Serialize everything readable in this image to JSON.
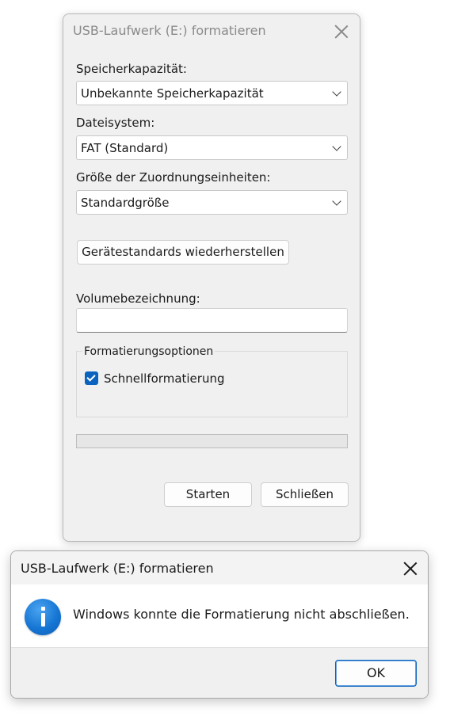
{
  "format_dialog": {
    "title": "USB-Laufwerk (E:) formatieren",
    "capacity_label": "Speicherkapazität:",
    "capacity_value": "Unbekannte Speicherkapazität",
    "filesystem_label": "Dateisystem:",
    "filesystem_value": "FAT (Standard)",
    "allocation_label": "Größe der Zuordnungseinheiten:",
    "allocation_value": "Standardgröße",
    "restore_defaults_label": "Gerätestandards wiederherstellen",
    "volume_label": "Volumebezeichnung:",
    "volume_value": "",
    "options_legend": "Formatierungsoptionen",
    "quick_format_label": "Schnellformatierung",
    "quick_format_checked": true,
    "progress_fraction": 0,
    "start_label": "Starten",
    "close_label": "Schließen"
  },
  "message_dialog": {
    "title": "USB-Laufwerk (E:) formatieren",
    "icon": "info-icon",
    "message": "Windows konnte die Formatierung nicht abschließen.",
    "ok_label": "OK"
  },
  "colors": {
    "accent": "#0b63c0",
    "dialog_bg": "#f0f0f0",
    "info_blue": "#1677d4"
  }
}
